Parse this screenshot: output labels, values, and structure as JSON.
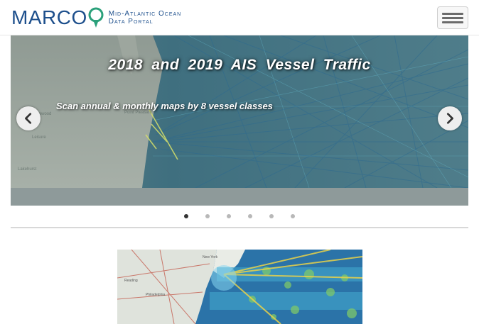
{
  "header": {
    "logo_text": "MARCO",
    "logo_subtitle_line1": "Mid-Atlantic Ocean",
    "logo_subtitle_line2": "Data Portal",
    "menu_icon": "hamburger-icon"
  },
  "carousel": {
    "slide_title": "2018 and 2019 AIS Vessel Traffic",
    "slide_subtitle": "Scan annual & monthly maps by 8 vessel classes",
    "prev_icon": "chevron-left-icon",
    "next_icon": "chevron-right-icon",
    "slide_count": 6,
    "active_slide": 1
  },
  "colors": {
    "brand_blue": "#1d4f8c",
    "brand_green": "#2aa07a",
    "traffic_blue": "#1f5c8a"
  }
}
